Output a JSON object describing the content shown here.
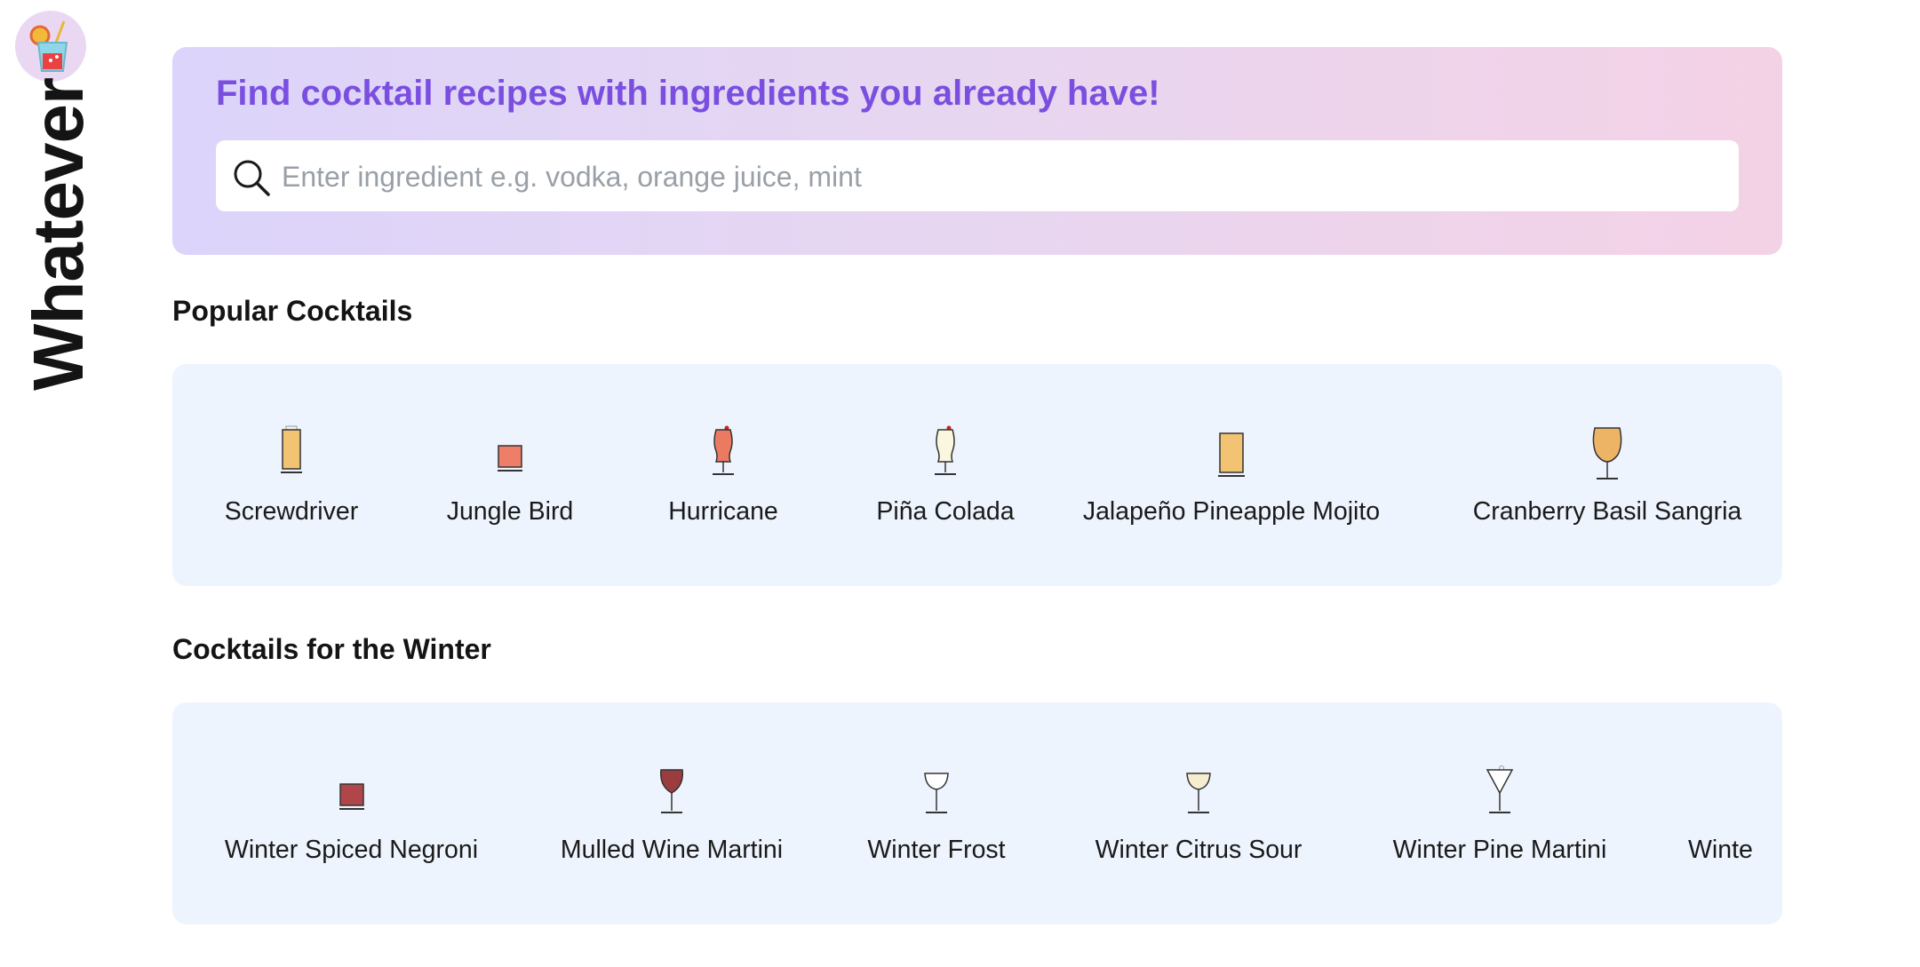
{
  "app": {
    "name": "Whatever"
  },
  "hero": {
    "title": "Find cocktail recipes with ingredients you already have!",
    "search_placeholder": "Enter ingredient e.g. vodka, orange juice, mint",
    "search_value": ""
  },
  "sections": {
    "popular": {
      "title": "Popular Cocktails",
      "items": [
        {
          "name": "Screwdriver",
          "icon": "highball-glass-icon",
          "color": "#f2c373"
        },
        {
          "name": "Jungle Bird",
          "icon": "rocks-glass-icon",
          "color": "#ee7e68"
        },
        {
          "name": "Hurricane",
          "icon": "hurricane-glass-icon",
          "color": "#ec7a62"
        },
        {
          "name": "Piña Colada",
          "icon": "hurricane-glass-icon",
          "color": "#fbf6df"
        },
        {
          "name": "Jalapeño Pineapple Mojito",
          "icon": "collins-glass-icon",
          "color": "#f2c373"
        },
        {
          "name": "Cranberry Basil Sangria",
          "icon": "balloon-glass-icon",
          "color": "#eeb466"
        }
      ]
    },
    "winter": {
      "title": "Cocktails for the Winter",
      "items": [
        {
          "name": "Winter Spiced Negroni",
          "icon": "rocks-glass-icon",
          "color": "#b0464a"
        },
        {
          "name": "Mulled Wine Martini",
          "icon": "wine-glass-icon",
          "color": "#9b3d3f"
        },
        {
          "name": "Winter Frost",
          "icon": "coupe-glass-icon",
          "color": "#ffffff"
        },
        {
          "name": "Winter Citrus Sour",
          "icon": "coupe-glass-icon",
          "color": "#f6ecd0"
        },
        {
          "name": "Winter Pine Martini",
          "icon": "martini-glass-icon",
          "color": "#ffffff"
        },
        {
          "name": "Winte",
          "icon": "",
          "color": ""
        }
      ]
    }
  }
}
